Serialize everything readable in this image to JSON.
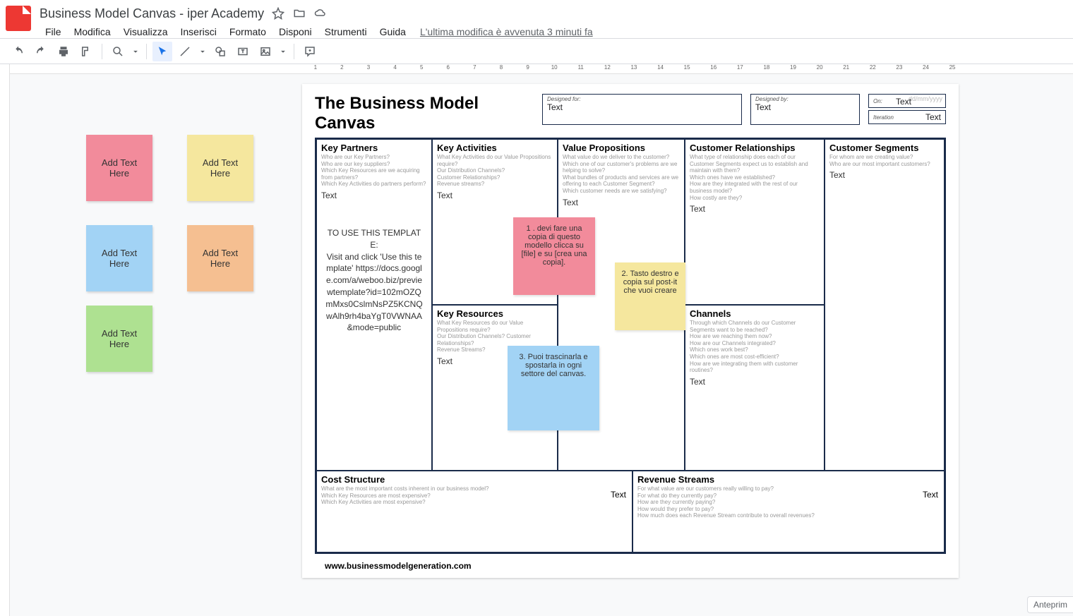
{
  "doc_title": "Business Model Canvas - iper Academy",
  "menus": [
    "File",
    "Modifica",
    "Visualizza",
    "Inserisci",
    "Formato",
    "Disponi",
    "Strumenti",
    "Guida"
  ],
  "last_edit": "L'ultima modifica è avvenuta 3 minuti fa",
  "ruler": [
    "1",
    "2",
    "3",
    "4",
    "5",
    "6",
    "7",
    "8",
    "9",
    "10",
    "11",
    "12",
    "13",
    "14",
    "15",
    "16",
    "17",
    "18",
    "19",
    "20",
    "21",
    "22",
    "23",
    "24",
    "25"
  ],
  "palette": {
    "add_text": "Add Text Here"
  },
  "slide_title": "The Business Model Canvas",
  "meta": {
    "designed_for_lbl": "Designed for:",
    "designed_for": "Text",
    "designed_by_lbl": "Designed by:",
    "designed_by": "Text",
    "on_lbl": "On:",
    "on_placeholder": "dd/mm/yyyy",
    "on": "Text",
    "iteration_lbl": "Iteration",
    "iteration": "Text"
  },
  "blocks": {
    "kp": {
      "title": "Key Partners",
      "hints": "Who are our Key Partners?\nWho are our key suppliers?\nWhich Key Resources are we acquiring from partners?\nWhich Key Activities do partners perform?",
      "text": "Text"
    },
    "ka": {
      "title": "Key Activities",
      "hints": "What Key Activities do our Value Propositions require?\nOur Distribution Channels?\nCustomer Relationships?\nRevenue streams?",
      "text": "Text"
    },
    "kr": {
      "title": "Key Resources",
      "hints": "What Key Resources do our Value Propositions require?\nOur Distribution Channels? Customer Relationships?\nRevenue Streams?",
      "text": "Text"
    },
    "vp": {
      "title": "Value Propositions",
      "hints": "What value do we deliver to the customer?\nWhich one of our customer's problems are we helping to solve?\nWhat bundles of products and services are we offering to each Customer Segment?\nWhich customer needs are we satisfying?",
      "text": "Text"
    },
    "cr": {
      "title": "Customer Relationships",
      "hints": "What type of relationship does each of our Customer Segments expect us to establish and maintain with them?\nWhich ones have we established?\nHow are they integrated with the rest of our business model?\nHow costly are they?",
      "text": "Text"
    },
    "ch": {
      "title": "Channels",
      "hints": "Through which Channels do our Customer Segments want to be reached?\nHow are we reaching them now?\nHow are our Channels integrated?\nWhich ones work best?\nWhich ones are most cost-efficient?\nHow are we integrating them with customer routines?",
      "text": "Text"
    },
    "cs": {
      "title": "Customer Segments",
      "hints": "For whom are we creating value?\nWho are our most important customers?",
      "text": "Text"
    },
    "cost": {
      "title": "Cost Structure",
      "hints": "What are the most important costs inherent in our business model?\nWhich Key Resources are most expensive?\nWhich Key Activities are most expensive?",
      "text": "Text"
    },
    "rev": {
      "title": "Revenue Streams",
      "hints": "For what value are our customers really willing to pay?\nFor what do they currently pay?\nHow are they currently paying?\nHow would they prefer to pay?\nHow much does each Revenue Stream contribute to overall revenues?",
      "text": "Text"
    }
  },
  "kp_instructions": "TO USE THIS TEMPLATE:\nVisit and click 'Use this template' https://docs.google.com/a/weboo.biz/previewtemplate?id=102mOZQmMxs0CslmNsPZ5KCNQwAlh9rh4baYgT0VWNAA&mode=public",
  "sticky_notes": {
    "n1": "1 . devi fare una copia di questo modello clicca su [file] e su [crea una copia].",
    "n2": "2. Tasto destro e copia sul post-it che vuoi creare",
    "n3": "3. Puoi trascinarla e spostarla in ogni settore del canvas."
  },
  "footer_url": "www.businessmodelgeneration.com",
  "preview_label": "Anteprim"
}
